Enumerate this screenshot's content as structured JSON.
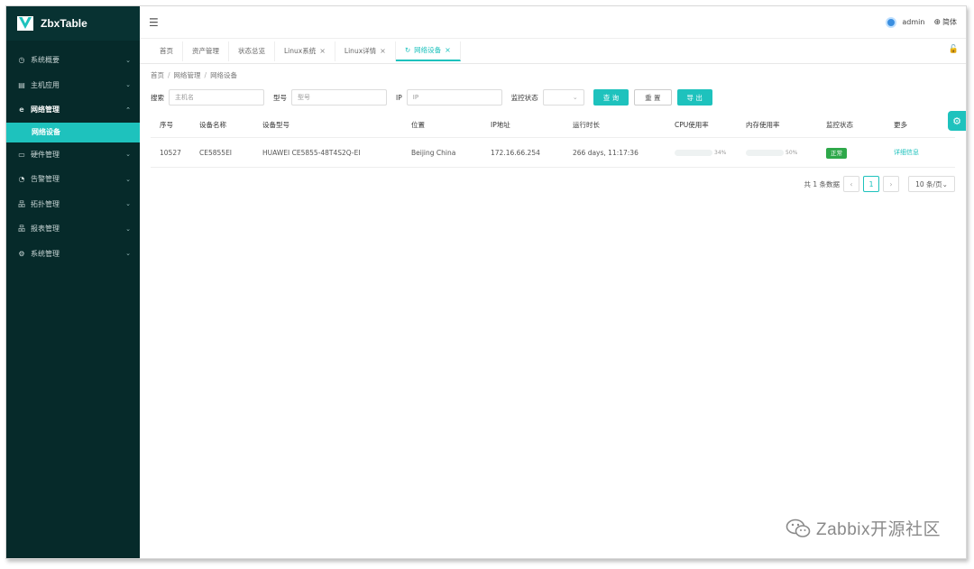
{
  "app": {
    "title": "ZbxTable"
  },
  "sidebar": {
    "items": [
      {
        "label": "系统概要",
        "icon": "clock-icon",
        "glyph": "◷",
        "arrow": "⌄"
      },
      {
        "label": "主机应用",
        "icon": "monitor-icon",
        "glyph": "▤",
        "arrow": "⌄"
      },
      {
        "label": "网络管理",
        "icon": "ie-icon",
        "glyph": "e",
        "arrow": "⌃"
      },
      {
        "label": "硬件管理",
        "icon": "folder-icon",
        "glyph": "▭",
        "arrow": "⌄"
      },
      {
        "label": "告警管理",
        "icon": "alert-icon",
        "glyph": "◔",
        "arrow": "⌄"
      },
      {
        "label": "拓扑管理",
        "icon": "topology-icon",
        "glyph": "品",
        "arrow": "⌄"
      },
      {
        "label": "报表管理",
        "icon": "report-icon",
        "glyph": "品",
        "arrow": "⌄"
      },
      {
        "label": "系统管理",
        "icon": "gear-icon",
        "glyph": "⚙",
        "arrow": "⌄"
      }
    ],
    "active_sub": "网络设备"
  },
  "header": {
    "user": "admin",
    "lang": "简体"
  },
  "tabs": [
    {
      "label": "首页",
      "closable": false
    },
    {
      "label": "资产管理",
      "closable": false
    },
    {
      "label": "状态总览",
      "closable": false
    },
    {
      "label": "Linux系统",
      "closable": true
    },
    {
      "label": "Linux详情",
      "closable": true
    },
    {
      "label": "网络设备",
      "closable": true,
      "active": true
    }
  ],
  "breadcrumb": [
    "首页",
    "网络管理",
    "网络设备"
  ],
  "search": {
    "label_search": "搜索",
    "placeholder_host": "主机名",
    "label_model": "型号",
    "placeholder_model": "型号",
    "label_ip": "IP",
    "placeholder_ip": "IP",
    "label_status": "监控状态",
    "btn_query": "查 询",
    "btn_reset": "重 置",
    "btn_export": "导 出"
  },
  "table": {
    "headers": [
      "序号",
      "设备名称",
      "设备型号",
      "位置",
      "IP地址",
      "运行时长",
      "CPU使用率",
      "内存使用率",
      "监控状态",
      "更多"
    ],
    "rows": [
      {
        "id": "10527",
        "name": "CE5855EI",
        "model": "HUAWEI CE5855-48T4S2Q-EI",
        "location": "Beijing China",
        "ip": "172.16.66.254",
        "uptime": "266 days, 11:17:36",
        "cpu": 34,
        "cpu_text": "34%",
        "mem": 50,
        "mem_text": "50%",
        "status": "正常",
        "more": "详细信息"
      }
    ]
  },
  "pagination": {
    "total_text": "共 1 条数据",
    "page": "1",
    "page_size": "10 条/页"
  },
  "watermark": "Zabbix开源社区",
  "colors": {
    "accent": "#1ec2bd",
    "sidebar": "#062a2a",
    "ok": "#2ea84a"
  }
}
